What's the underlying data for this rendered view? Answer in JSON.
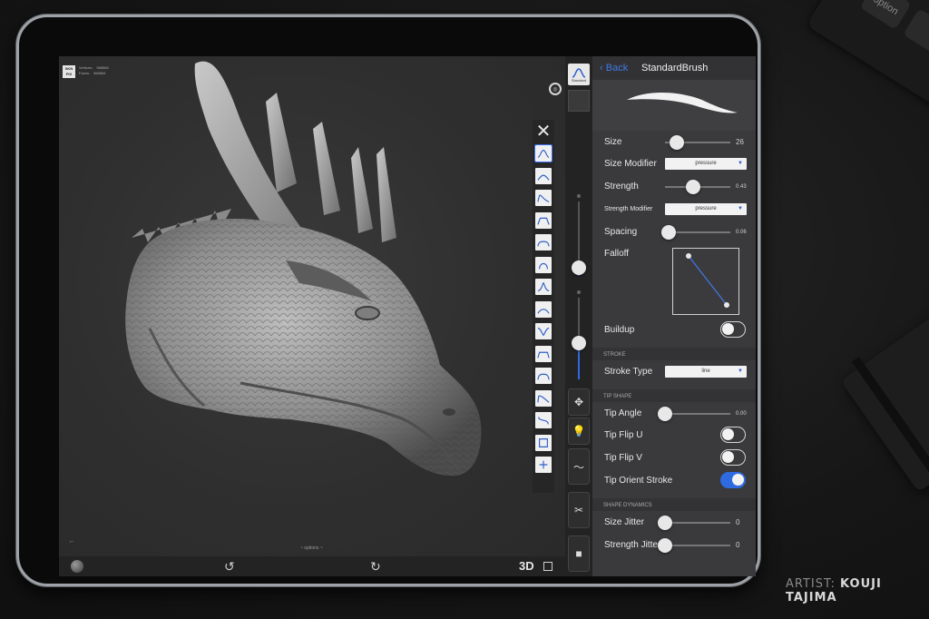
{
  "background": {
    "keyboard_key_label": "option",
    "credit": {
      "prefix": "ARTIST:",
      "name": "KOUJI TAJIMA"
    }
  },
  "viewport": {
    "stats": {
      "logo_lines": [
        "SKN",
        "PIX"
      ],
      "vertices_label": "Vertices:",
      "vertices_value": "968586",
      "faces_label": "Faces:",
      "faces_value": "968584"
    },
    "hint": "~ options ~",
    "bottom_bar": {
      "mode_label": "3D"
    }
  },
  "brush_strip": {
    "items": [
      {
        "name": "Standard",
        "active": true
      },
      {
        "name": "Clay"
      },
      {
        "name": "Move"
      },
      {
        "name": "Flatten"
      },
      {
        "name": "Layer"
      },
      {
        "name": "Inflate"
      },
      {
        "name": "Pinch"
      },
      {
        "name": "Smooth"
      },
      {
        "name": "Crease"
      },
      {
        "name": "Scrape"
      },
      {
        "name": "Polish"
      },
      {
        "name": "Fill"
      },
      {
        "name": "Trim"
      },
      {
        "name": "Mask"
      },
      {
        "name": "Transform"
      }
    ]
  },
  "side_column": {
    "top_button_label": "Standard",
    "size_slider_value": 0.55,
    "strength_slider_value": 0.43
  },
  "panel": {
    "back_label": "Back",
    "title": "StandardBrush",
    "size": {
      "label": "Size",
      "value": "26",
      "slider": 0.18
    },
    "size_modifier": {
      "label": "Size Modifier",
      "value": "pressure"
    },
    "strength": {
      "label": "Strength",
      "value": "0.43",
      "slider": 0.43
    },
    "strength_modifier": {
      "label": "Strength Modifier",
      "value": "pressure"
    },
    "spacing": {
      "label": "Spacing",
      "value": "0.06",
      "slider": 0.06
    },
    "falloff": {
      "label": "Falloff"
    },
    "buildup": {
      "label": "Buildup",
      "on": false
    },
    "stroke_section": "STROKE",
    "stroke_type": {
      "label": "Stroke Type",
      "value": "line"
    },
    "tip_section": "TIP SHAPE",
    "tip_angle": {
      "label": "Tip Angle",
      "value": "0.00",
      "slider": 0.0
    },
    "tip_flip_u": {
      "label": "Tip Flip U",
      "on": false
    },
    "tip_flip_v": {
      "label": "Tip Flip V",
      "on": false
    },
    "tip_orient_stroke": {
      "label": "Tip Orient Stroke",
      "on": true
    },
    "dynamics_section": "SHAPE DYNAMICS",
    "size_jitter": {
      "label": "Size Jitter",
      "value": "0",
      "slider": 0.0
    },
    "strength_jitter": {
      "label": "Strength Jitter",
      "value": "0",
      "slider": 0.0
    }
  },
  "colors": {
    "accent": "#2f6be0",
    "panel_bg": "#3a3a3c",
    "viewport_bg": "#2f2f2f"
  }
}
